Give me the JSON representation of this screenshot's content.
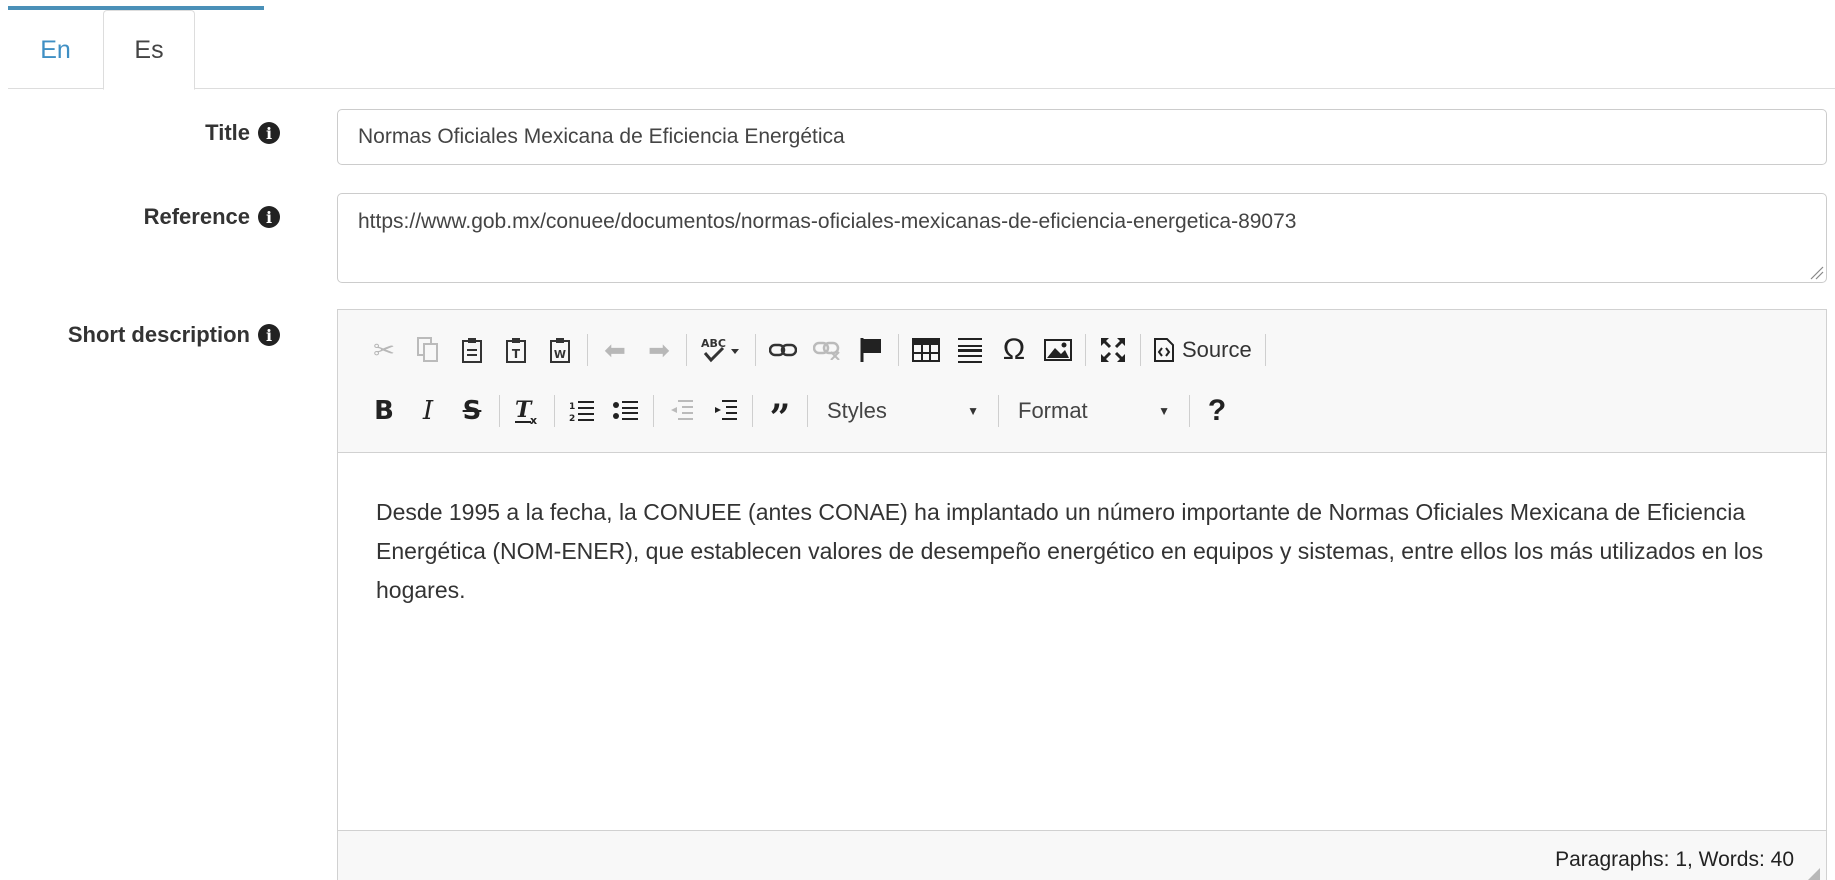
{
  "tabs": [
    {
      "label": "En"
    },
    {
      "label": "Es"
    }
  ],
  "fields": {
    "title_label": "Title",
    "title_value": "Normas Oficiales Mexicana de Eficiencia Energética",
    "reference_label": "Reference",
    "reference_value": "https://www.gob.mx/conuee/documentos/normas-oficiales-mexicanas-de-eficiencia-energetica-89073",
    "short_description_label": "Short description"
  },
  "editor": {
    "toolbar": {
      "source_label": "Source",
      "styles_label": "Styles",
      "format_label": "Format",
      "help_label": "?"
    },
    "content": "Desde 1995 a la fecha, la CONUEE (antes CONAE) ha implantado un número importante de Normas Oficiales Mexicana de Eficiencia Energética (NOM-ENER), que establecen valores de desempeño energético en equipos y sistemas, entre ellos los más utilizados en los hogares.",
    "status": "Paragraphs: 1, Words: 40"
  },
  "colors": {
    "accent": "#3f8fc4",
    "toolbar_bg": "#f8f8f8",
    "border": "#d1d1d1"
  }
}
